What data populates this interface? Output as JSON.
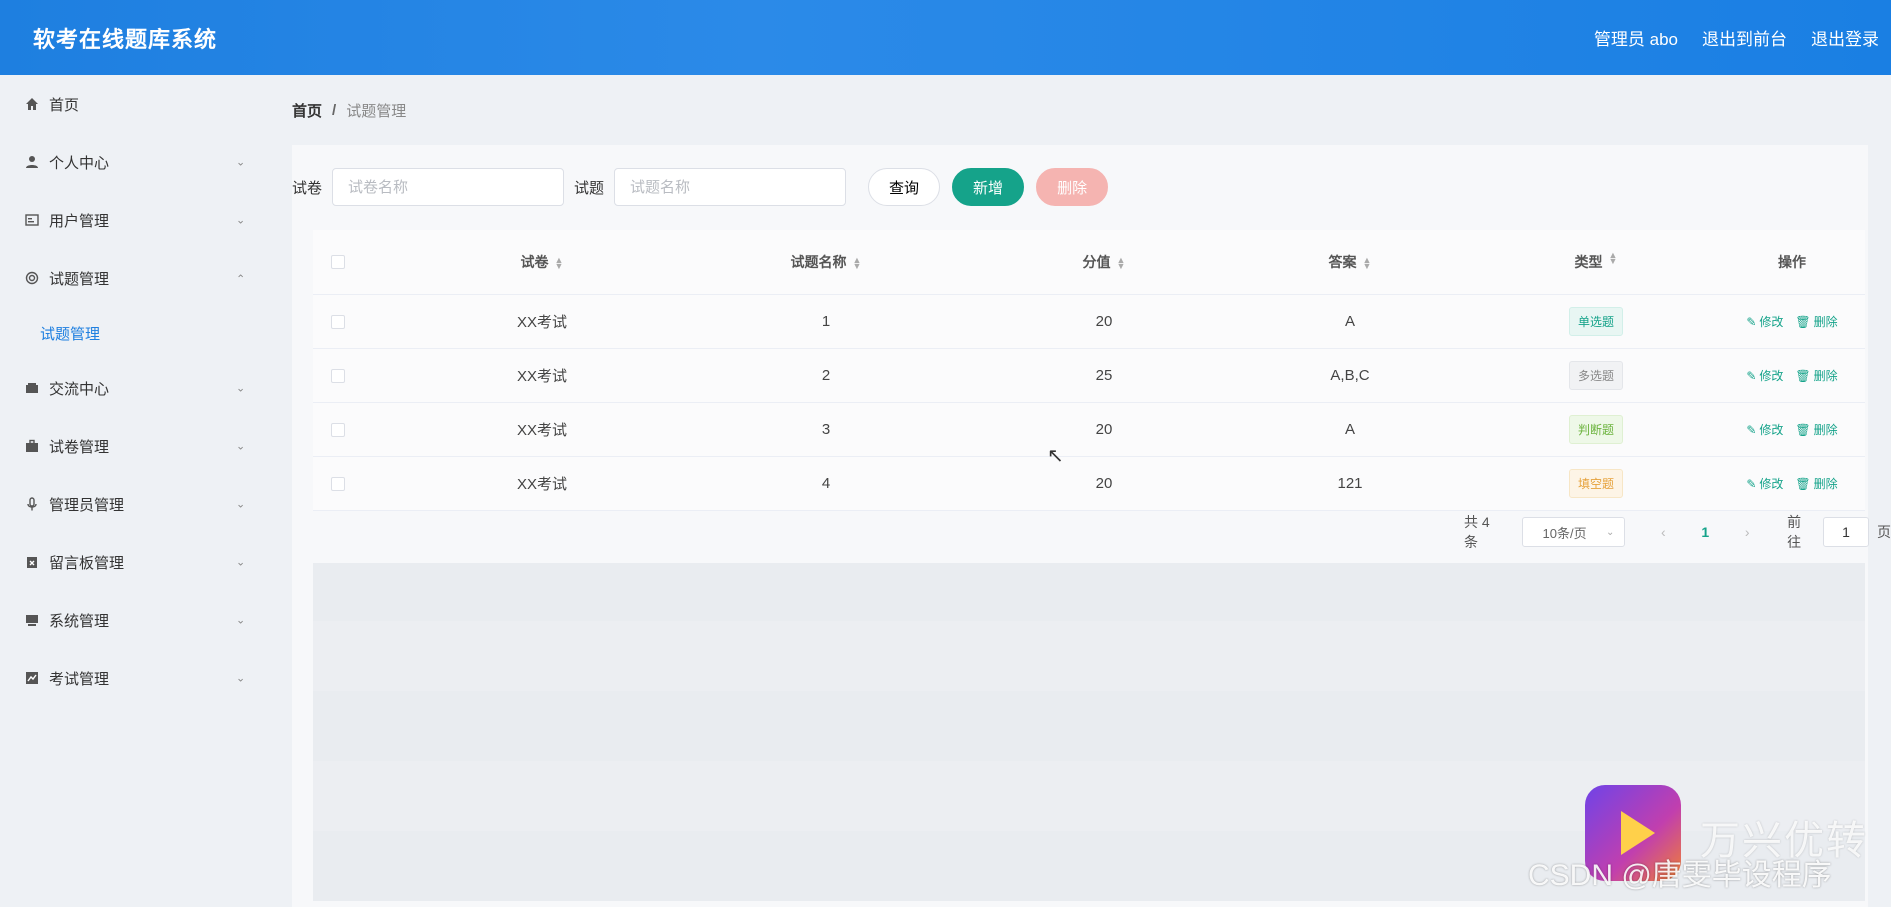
{
  "app": {
    "title": "软考在线题库系统"
  },
  "header": {
    "admin_label": "管理员 abo",
    "exit_front": "退出到前台",
    "logout": "退出登录"
  },
  "sidebar": {
    "items": [
      {
        "label": "首页",
        "icon": "home-icon"
      },
      {
        "label": "个人中心",
        "icon": "user-icon"
      },
      {
        "label": "用户管理",
        "icon": "id-card-icon"
      },
      {
        "label": "试题管理",
        "icon": "lifebuoy-icon",
        "expanded": true
      },
      {
        "label": "交流中心",
        "icon": "wallet-icon"
      },
      {
        "label": "试卷管理",
        "icon": "briefcase-icon"
      },
      {
        "label": "管理员管理",
        "icon": "microphone-icon"
      },
      {
        "label": "留言板管理",
        "icon": "clipboard-icon"
      },
      {
        "label": "系统管理",
        "icon": "monitor-icon"
      },
      {
        "label": "考试管理",
        "icon": "chart-icon"
      }
    ],
    "subitem": "试题管理"
  },
  "breadcrumb": {
    "home": "首页",
    "separator": "/",
    "current": "试题管理"
  },
  "filter": {
    "paper_label": "试卷",
    "paper_placeholder": "试卷名称",
    "question_label": "试题",
    "question_placeholder": "试题名称",
    "search_btn": "查询",
    "add_btn": "新增",
    "delete_btn": "删除"
  },
  "table": {
    "headers": {
      "paper": "试卷",
      "name": "试题名称",
      "score": "分值",
      "answer": "答案",
      "type": "类型",
      "ops": "操作"
    },
    "edit_label": "修改",
    "delete_label": "删除",
    "rows": [
      {
        "paper": "XX考试",
        "name": "1",
        "score": "20",
        "answer": "A",
        "type": "单选题"
      },
      {
        "paper": "XX考试",
        "name": "2",
        "score": "25",
        "answer": "A,B,C",
        "type": "多选题"
      },
      {
        "paper": "XX考试",
        "name": "3",
        "score": "20",
        "answer": "A",
        "type": "判断题"
      },
      {
        "paper": "XX考试",
        "name": "4",
        "score": "20",
        "answer": "121",
        "type": "填空题"
      }
    ]
  },
  "pagination": {
    "total": "共 4 条",
    "page_size": "10条/页",
    "prev": "‹",
    "current": "1",
    "next": "›",
    "goto_label": "前往",
    "goto_value": "1",
    "page_suffix": "页"
  },
  "colors": {
    "primary": "#1e7fe0",
    "accent": "#15a38a",
    "danger_light": "#f5b4b1"
  },
  "watermark": {
    "brand": "万兴优转",
    "csdn": "CSDN @唐雯毕设程序"
  }
}
